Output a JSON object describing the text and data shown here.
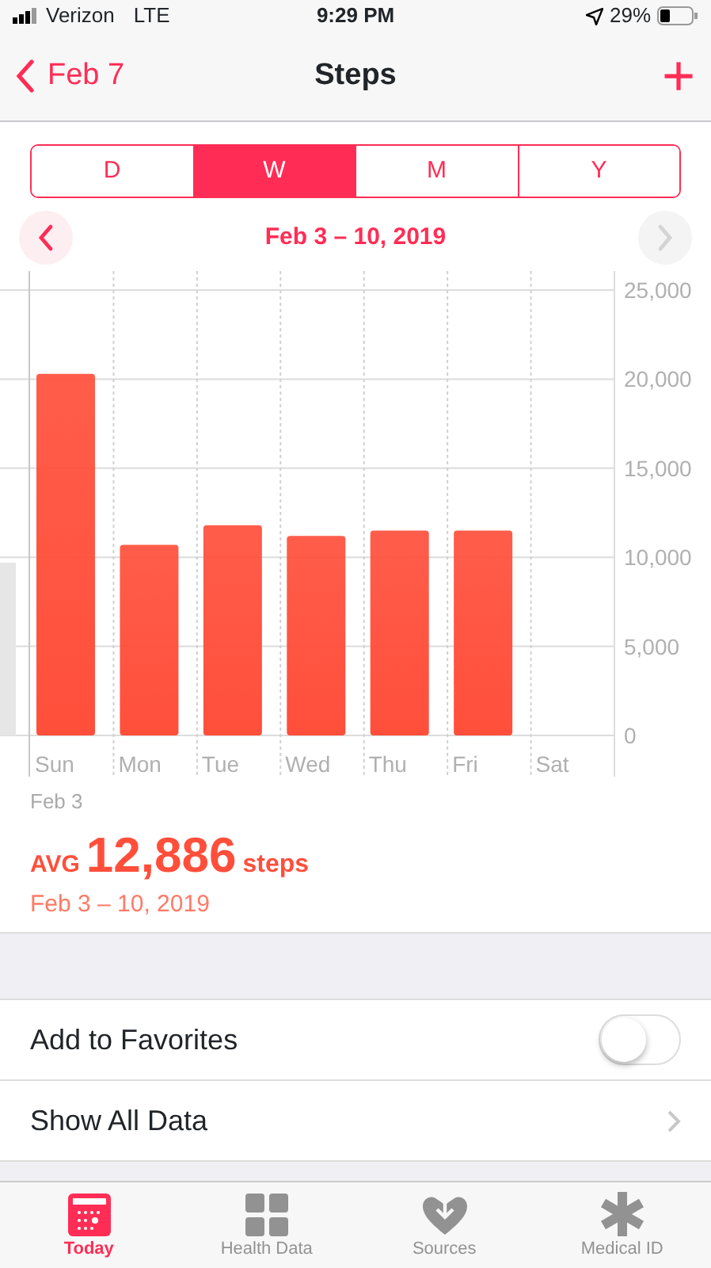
{
  "status_bar": {
    "carrier": "Verizon",
    "network": "LTE",
    "time": "9:29 PM",
    "battery": "29%"
  },
  "nav": {
    "back": "Feb 7",
    "title": "Steps",
    "add": "+"
  },
  "segments": [
    {
      "label": "D",
      "selected": false
    },
    {
      "label": "W",
      "selected": true
    },
    {
      "label": "M",
      "selected": false
    },
    {
      "label": "Y",
      "selected": false
    }
  ],
  "range": {
    "label": "Feb 3 – 10, 2019",
    "prev_enabled": true,
    "next_enabled": false
  },
  "chart_data": {
    "type": "bar",
    "categories": [
      "Sun",
      "Mon",
      "Tue",
      "Wed",
      "Thu",
      "Fri",
      "Sat"
    ],
    "series": [
      {
        "color": "#ff4f3b",
        "values": [
          20300,
          10700,
          11800,
          11200,
          11500,
          11500,
          null
        ]
      }
    ],
    "grid": true,
    "ylim": [
      0,
      25000
    ],
    "yticks": [
      {
        "value": 0,
        "label": "0"
      },
      {
        "value": 5000,
        "label": "5,000"
      },
      {
        "value": 10000,
        "label": "10,000"
      },
      {
        "value": 15000,
        "label": "15,000"
      },
      {
        "value": 20000,
        "label": "20,000"
      },
      {
        "value": 25000,
        "label": "25,000"
      }
    ]
  },
  "chart_start": "Feb 3",
  "summary": {
    "prefix": "AVG",
    "value": "12,886",
    "unit": "steps",
    "range": "Feb 3 – 10, 2019"
  },
  "rows": [
    {
      "kind": "toggle",
      "label": "Add to Favorites",
      "on": false
    },
    {
      "kind": "link",
      "label": "Show All Data"
    }
  ],
  "tabs": [
    {
      "label": "Today",
      "selected": true
    },
    {
      "label": "Health Data",
      "selected": false
    },
    {
      "label": "Sources",
      "selected": false
    },
    {
      "label": "Medical ID",
      "selected": false
    }
  ]
}
